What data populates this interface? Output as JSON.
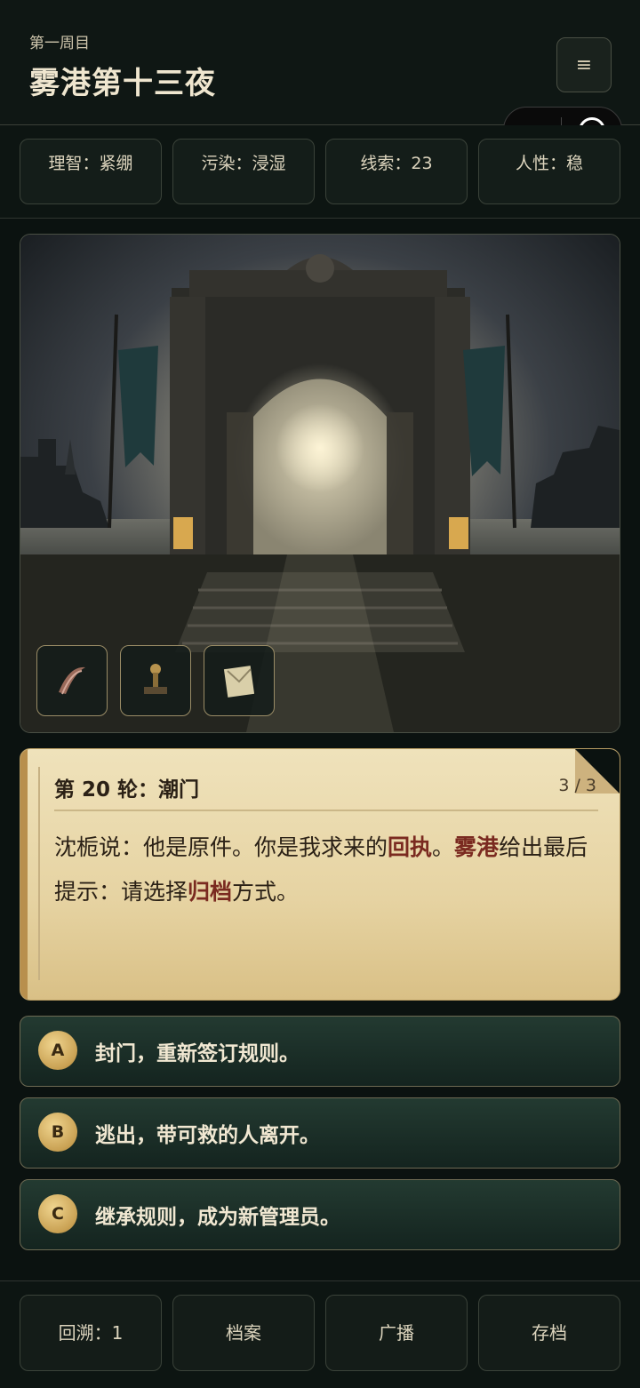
{
  "header": {
    "subtitle": "第一周目",
    "title": "雾港第十三夜",
    "menu_icon": "≡"
  },
  "capsule": {
    "more_icon": "•••",
    "close_icon": "target-circle"
  },
  "stats": [
    {
      "label": "理智：紧绷"
    },
    {
      "label": "污染：浸湿"
    },
    {
      "label": "线索：23"
    },
    {
      "label": "人性：稳"
    }
  ],
  "inventory": [
    {
      "icon": "ribbon-icon"
    },
    {
      "icon": "seal-stamp-icon"
    },
    {
      "icon": "envelope-icon"
    }
  ],
  "card": {
    "title": "第 20 轮：潮门",
    "count": "3 / 3",
    "text_a": "沈栀说：他是原件。你是我求来的",
    "hl_1": "回执",
    "text_b": "。",
    "hl_2": "雾港",
    "text_c": "给出最后提示：请选择",
    "hl_3": "归档",
    "text_d": "方式。"
  },
  "choices": [
    {
      "key": "A",
      "label": "封门，重新签订规则。"
    },
    {
      "key": "B",
      "label": "逃出，带可救的人离开。"
    },
    {
      "key": "C",
      "label": "继承规则，成为新管理员。"
    }
  ],
  "footer": [
    {
      "label": "回溯：1"
    },
    {
      "label": "档案"
    },
    {
      "label": "广播"
    },
    {
      "label": "存档"
    }
  ],
  "colors": {
    "background": "#0b1210",
    "accent_gold": "#c9a153",
    "highlight_red": "#7a2a20",
    "parchment": "#e6d3a2"
  }
}
